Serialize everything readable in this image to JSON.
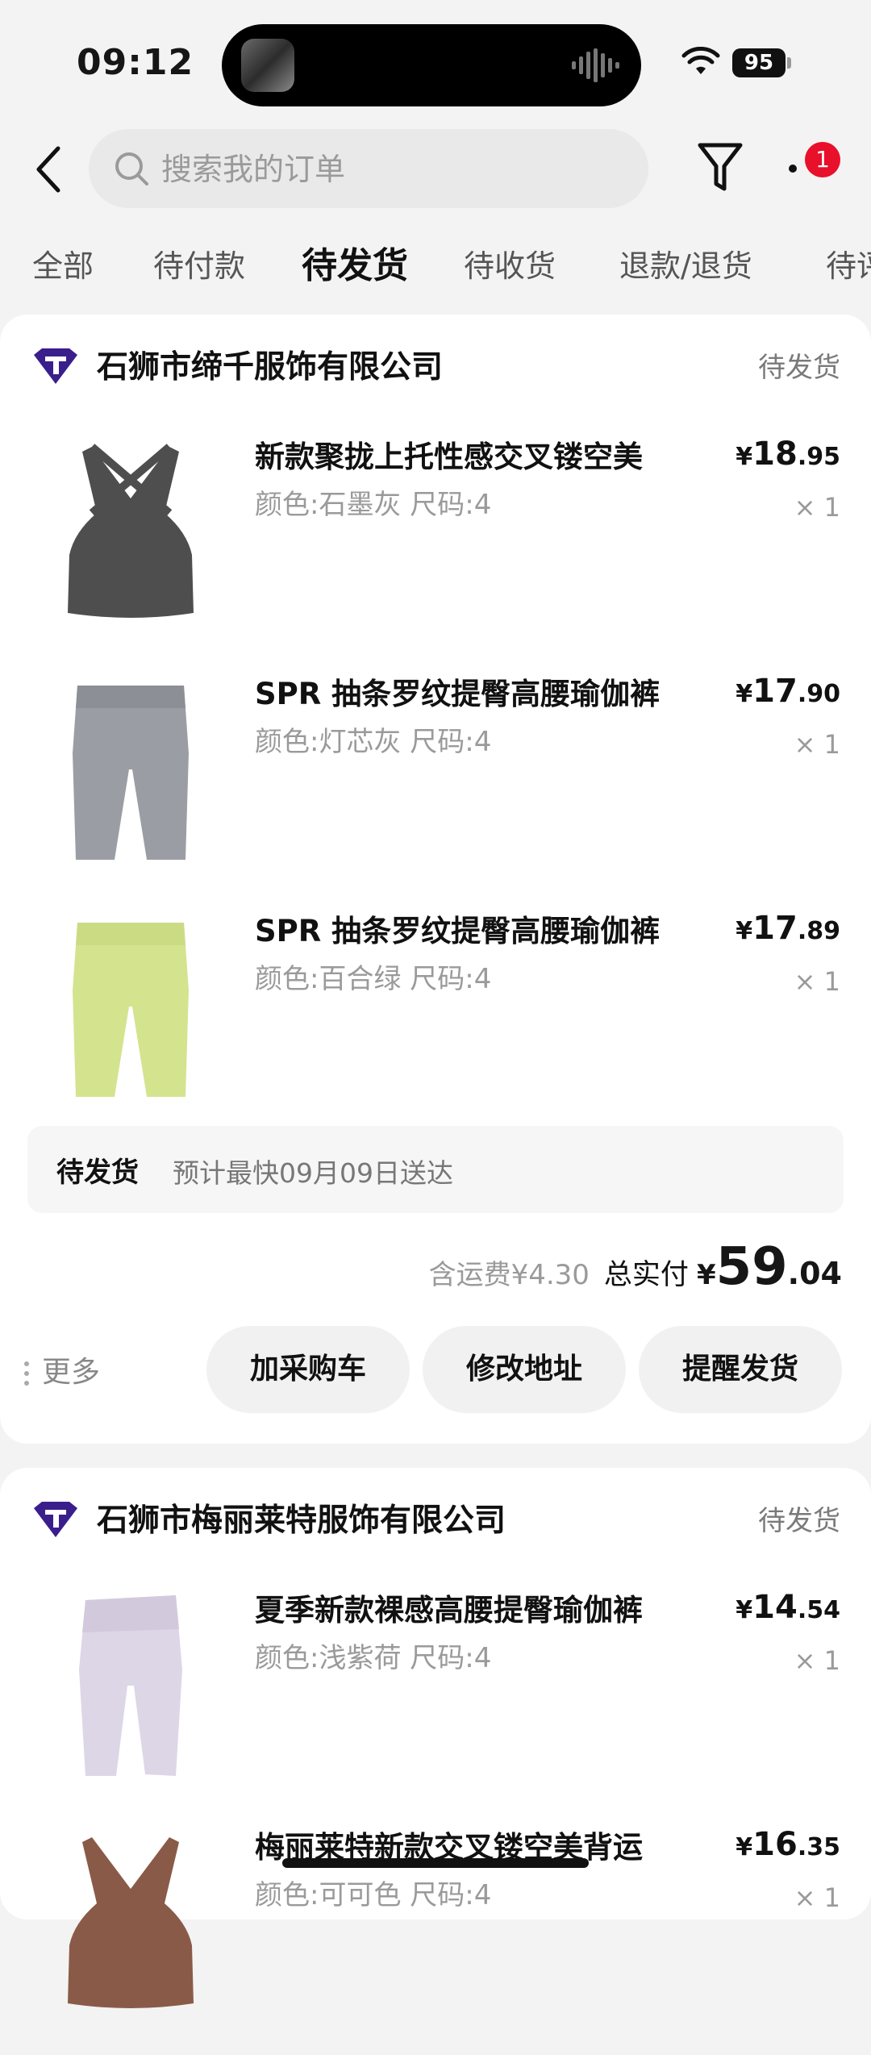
{
  "status_bar": {
    "time": "09:12",
    "battery": "95"
  },
  "search": {
    "placeholder": "搜索我的订单"
  },
  "header": {
    "badge_count": "1"
  },
  "tabs": [
    "全部",
    "待付款",
    "待发货",
    "待收货",
    "退款/退货",
    "待评价"
  ],
  "active_tab": "待发货",
  "orders": [
    {
      "shop": "石狮市缔千服饰有限公司",
      "status": "待发货",
      "items": [
        {
          "title": "新款聚拢上托性感交叉镂空美",
          "spec": "颜色:石墨灰 尺码:4",
          "price_yen": "¥",
          "price_int": "18",
          "price_dec": ".95",
          "qty": "× 1",
          "color": "#4e4e4e",
          "kind": "bra"
        },
        {
          "title": "SPR 抽条罗纹提臀高腰瑜伽裤",
          "spec": "颜色:灯芯灰 尺码:4",
          "price_yen": "¥",
          "price_int": "17",
          "price_dec": ".90",
          "qty": "× 1",
          "color": "#9a9da3",
          "kind": "shorts"
        },
        {
          "title": "SPR 抽条罗纹提臀高腰瑜伽裤",
          "spec": "颜色:百合绿 尺码:4",
          "price_yen": "¥",
          "price_int": "17",
          "price_dec": ".89",
          "qty": "× 1",
          "color": "#d4e38e",
          "kind": "shorts"
        }
      ],
      "shipping": {
        "label": "待发货",
        "eta": "预计最快09月09日送达"
      },
      "fee": "含运费¥4.30",
      "total_label": "总实付",
      "total_yen": "¥",
      "total_int": "59",
      "total_dec": ".04",
      "more_label": "更多",
      "actions": [
        "加采购车",
        "修改地址",
        "提醒发货"
      ]
    },
    {
      "shop": "石狮市梅丽莱特服饰有限公司",
      "status": "待发货",
      "items": [
        {
          "title": "夏季新款裸感高腰提臀瑜伽裤",
          "spec": "颜色:浅紫荷 尺码:4",
          "price_yen": "¥",
          "price_int": "14",
          "price_dec": ".54",
          "qty": "× 1",
          "color": "#ddd6e6",
          "kind": "shorts"
        },
        {
          "title": "梅丽莱特新款交叉镂空美背运",
          "spec": "颜色:可可色 尺码:4",
          "price_yen": "¥",
          "price_int": "16",
          "price_dec": ".35",
          "qty": "× 1",
          "color": "#8a5a48",
          "kind": "bra"
        }
      ]
    }
  ]
}
